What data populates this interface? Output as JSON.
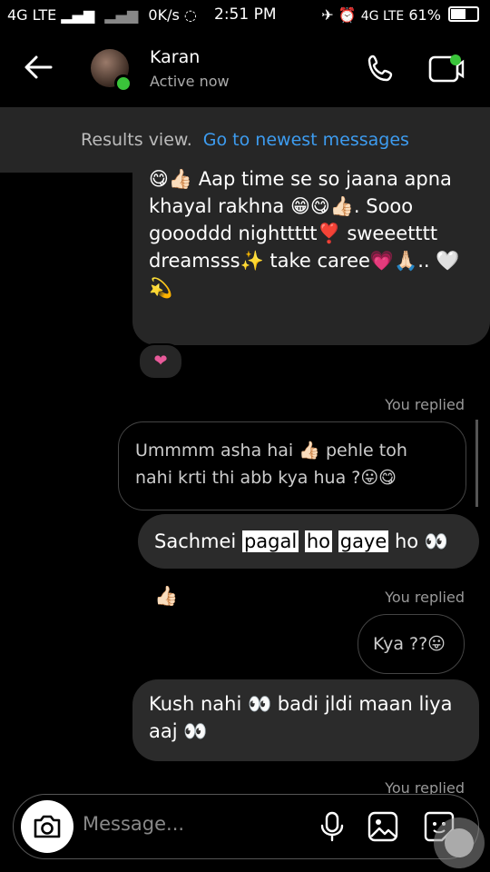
{
  "status_bar": {
    "left_text": "4G LTE",
    "speed": "0K/s",
    "time": "2:51 PM",
    "network_right": "4G LTE",
    "battery": "61%"
  },
  "header": {
    "contact_name": "Karan",
    "contact_status": "Active now"
  },
  "results_bar": {
    "text": "Results view.",
    "link": "Go to newest messages"
  },
  "messages": [
    {
      "sender": "them",
      "text": "😋👍🏻 Aap time se so jaana apna khayal rakhna 😁😋👍🏻. Sooo goooddd nighttttt❣️ sweeetttt dreamsss✨ take caree💗🙏🏻.. 🤍💫",
      "reaction": "❤"
    },
    {
      "label": "You replied",
      "sender": "me",
      "text": "Ummmm asha hai 👍🏻 pehle toh nahi krti thi abb kya hua ?😛😋"
    },
    {
      "sender": "them",
      "text_pre": "Sachmei ",
      "highlight_1": "pagal",
      "highlight_2": "ho",
      "highlight_3": "gaye",
      "text_post": " ho 👀👍🏻"
    },
    {
      "label": "You replied",
      "sender": "me",
      "text": "Kya ??😛"
    },
    {
      "sender": "them",
      "text": "Kush nahi 👀 badi jldi maan liya aaj 👀"
    },
    {
      "label": "You replied"
    }
  ],
  "composer": {
    "placeholder": "Message..."
  }
}
